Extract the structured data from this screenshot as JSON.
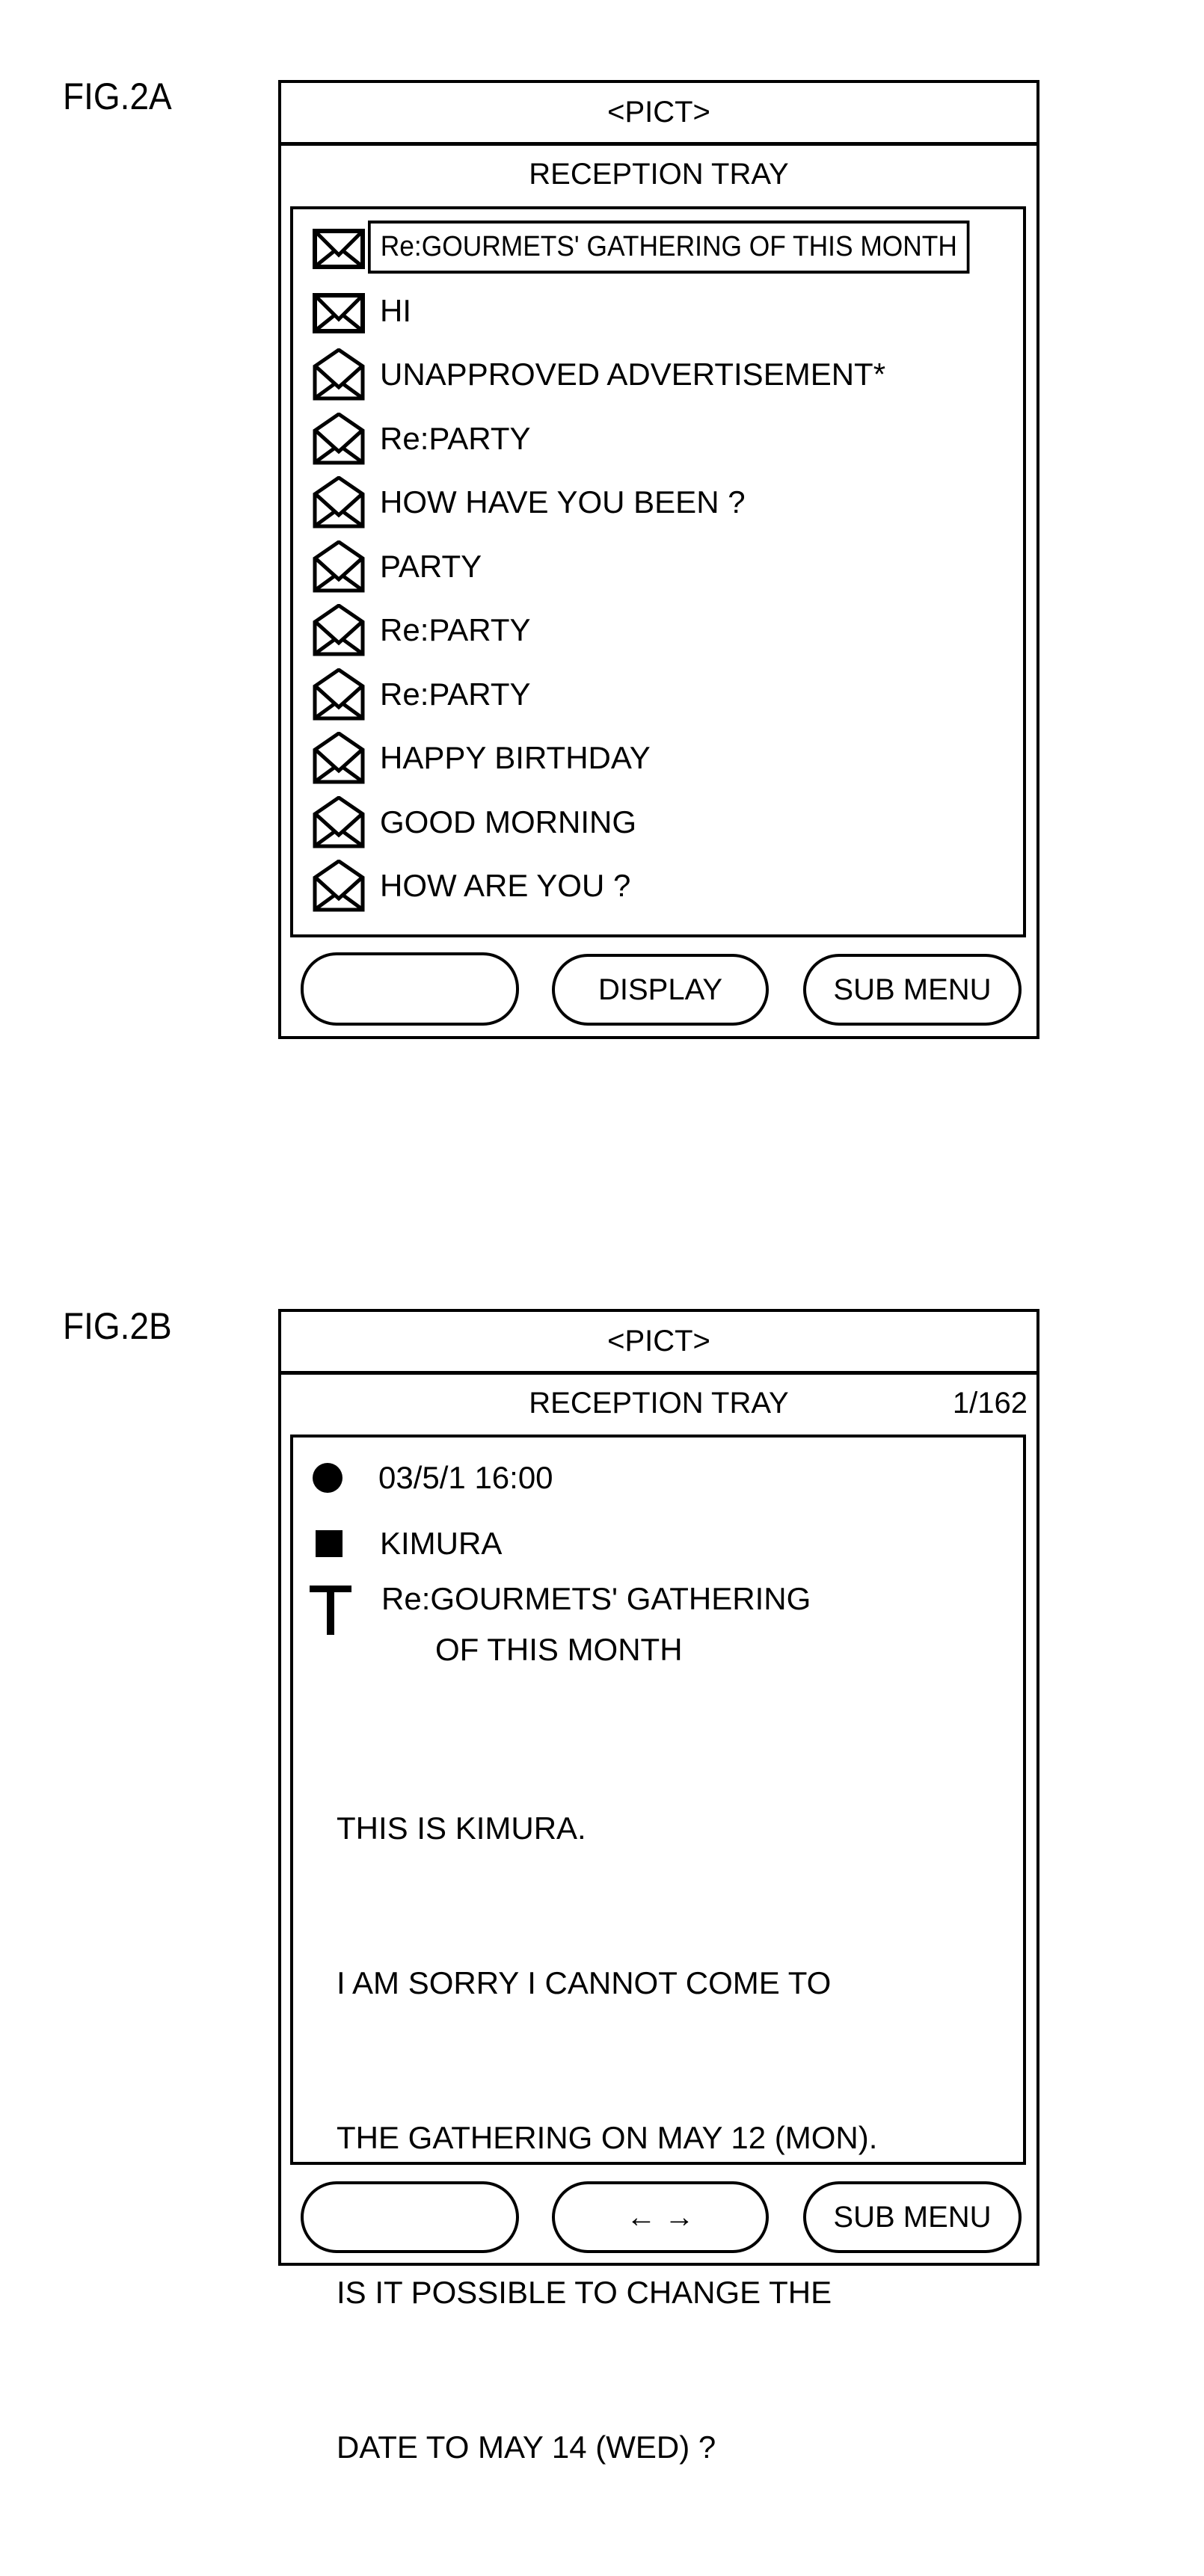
{
  "figures": [
    {
      "label": "FIG.2A",
      "header": "<PICT>",
      "title": "RECEPTION TRAY",
      "messages": [
        {
          "subject": "Re:GOURMETS' GATHERING OF THIS MONTH",
          "icon": "closed-envelope-icon",
          "state": "unread",
          "selected": true
        },
        {
          "subject": "HI",
          "icon": "closed-envelope-icon",
          "state": "unread",
          "selected": false
        },
        {
          "subject": "UNAPPROVED ADVERTISEMENT*",
          "icon": "open-envelope-icon",
          "state": "read",
          "selected": false
        },
        {
          "subject": "Re:PARTY",
          "icon": "open-envelope-icon",
          "state": "read",
          "selected": false
        },
        {
          "subject": "HOW HAVE YOU BEEN ?",
          "icon": "open-envelope-icon",
          "state": "read",
          "selected": false
        },
        {
          "subject": "PARTY",
          "icon": "open-envelope-icon",
          "state": "read",
          "selected": false
        },
        {
          "subject": "Re:PARTY",
          "icon": "open-envelope-icon",
          "state": "read",
          "selected": false
        },
        {
          "subject": "Re:PARTY",
          "icon": "open-envelope-icon",
          "state": "read",
          "selected": false
        },
        {
          "subject": "HAPPY BIRTHDAY",
          "icon": "open-envelope-icon",
          "state": "read",
          "selected": false
        },
        {
          "subject": "GOOD MORNING",
          "icon": "open-envelope-icon",
          "state": "read",
          "selected": false
        },
        {
          "subject": "HOW ARE YOU ?",
          "icon": "open-envelope-icon",
          "state": "read",
          "selected": false
        }
      ],
      "buttons": [
        "",
        "DISPLAY",
        "SUB MENU"
      ]
    },
    {
      "label": "FIG.2B",
      "header": "<PICT>",
      "title": "RECEPTION TRAY",
      "counter": "1/162",
      "date": {
        "icon": "filled-circle-icon",
        "value": "03/5/1 16:00"
      },
      "sender": {
        "icon": "filled-square-icon",
        "value": "KIMURA"
      },
      "subject": {
        "icon": "title-t-icon",
        "line1": "Re:GOURMETS' GATHERING",
        "line2": "OF THIS MONTH"
      },
      "body_lines": [
        "THIS IS KIMURA.",
        "I AM SORRY I CANNOT COME TO",
        "THE GATHERING ON MAY 12 (MON).",
        "IS IT POSSIBLE TO CHANGE THE",
        "DATE TO MAY 14 (WED) ?"
      ],
      "buttons": [
        "",
        "← →",
        "SUB MENU"
      ]
    }
  ]
}
